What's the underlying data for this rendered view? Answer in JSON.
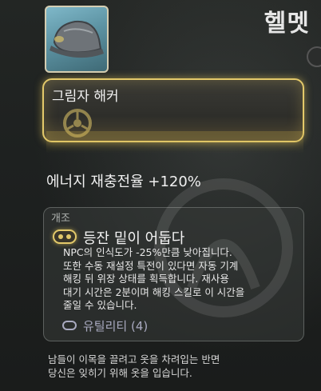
{
  "header": {
    "title": "헬멧"
  },
  "equipped_mod": {
    "name": "그림자 해커"
  },
  "stat": {
    "text": "에너지 재충전율 +120%"
  },
  "mod_section": {
    "label": "개조",
    "title": "등잔 밑이 어둡다",
    "description": "NPC의 인식도가 -25%만큼 낮아집니다.\n또한 수동 재설정 특전이 있다면 자동 기계\n해킹 뒤 위장 상태를 획득합니다. 재사용\n대기 시간은 2분이며 해킹 스킬로 이 시간을\n줄일 수 있습니다.",
    "utility_label": "유틸리티 (4)"
  },
  "flavor_text": "남들이 이목을 끌려고 옷을 차려입는 반면\n당신은 잊히기 위해 옷을 입습니다.",
  "colors": {
    "accent_gold": "#e3c96a",
    "utility_blue": "#a9aac0"
  }
}
